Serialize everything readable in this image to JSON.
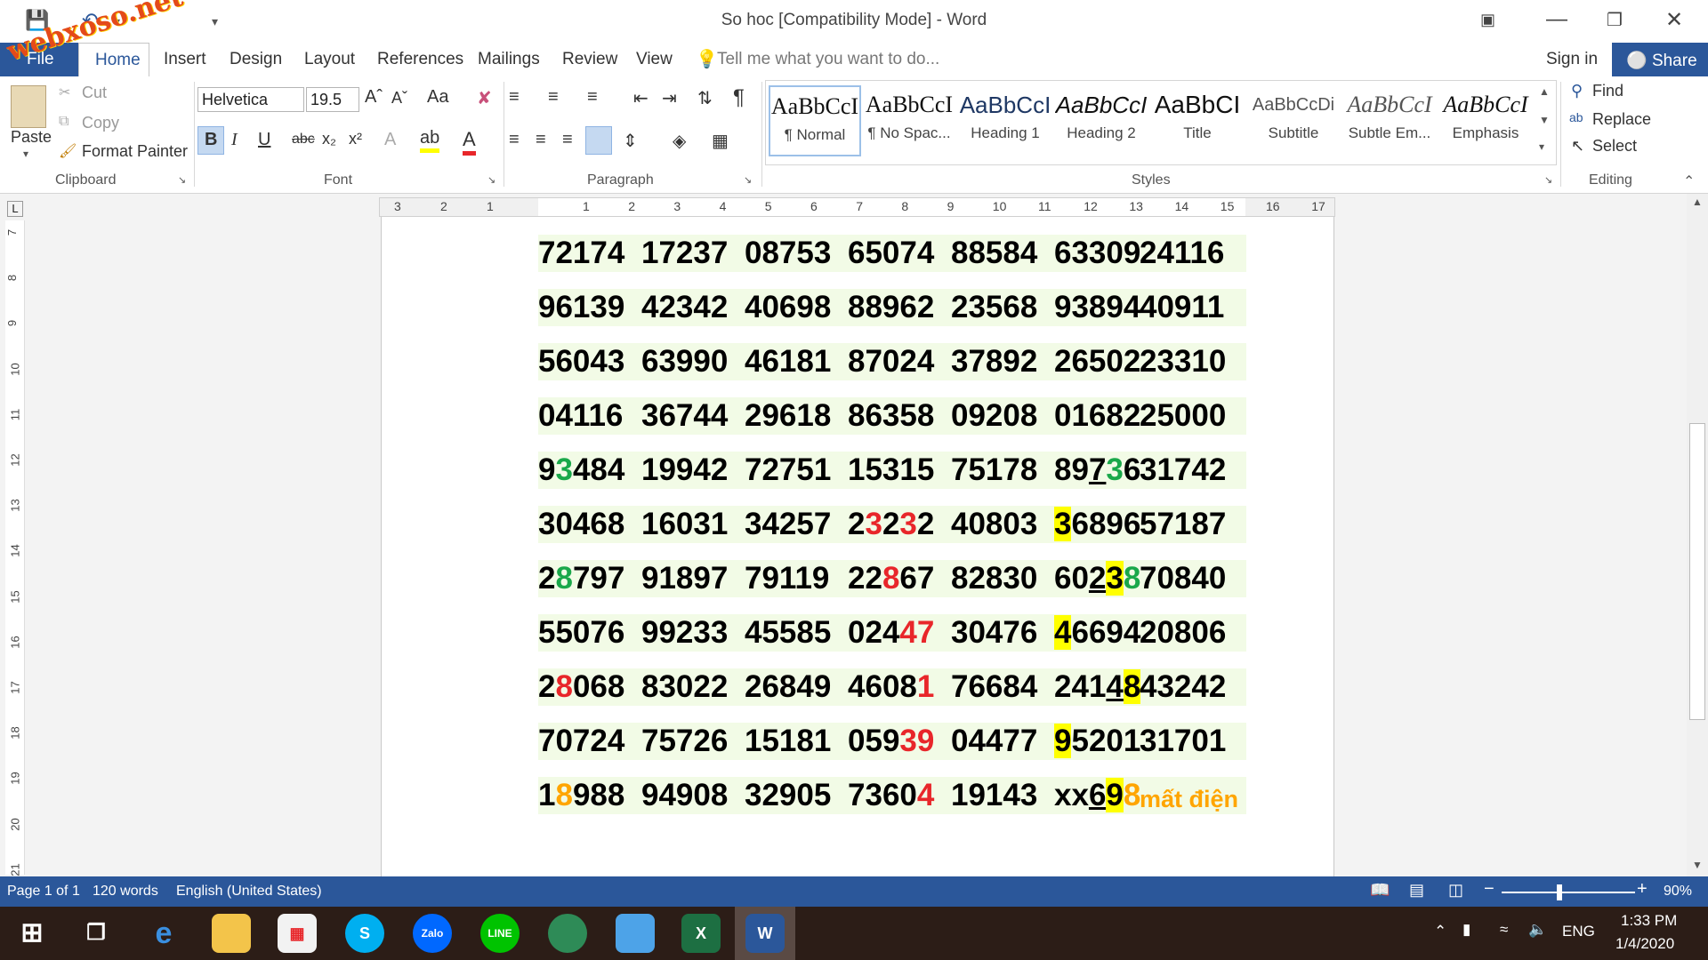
{
  "window": {
    "title": "So hoc [Compatibility Mode] - Word"
  },
  "watermark": "webxoso.net",
  "tabs": {
    "file": "File",
    "home": "Home",
    "items": [
      "Insert",
      "Design",
      "Layout",
      "References",
      "Mailings",
      "Review",
      "View"
    ],
    "tell_me": "Tell me what you want to do...",
    "sign_in": "Sign in",
    "share": "Share"
  },
  "clipboard": {
    "paste": "Paste",
    "cut": "Cut",
    "copy": "Copy",
    "format_painter": "Format Painter",
    "label": "Clipboard"
  },
  "font": {
    "name": "Helvetica",
    "size": "19.5",
    "label": "Font",
    "change_case": "Aa",
    "bold": "B",
    "italic": "I",
    "underline": "U",
    "strike": "abc"
  },
  "paragraph": {
    "label": "Paragraph"
  },
  "styles": {
    "label": "Styles",
    "items": [
      {
        "sample": "AaBbCcI",
        "name": "¶ Normal"
      },
      {
        "sample": "AaBbCcI",
        "name": "¶ No Spac..."
      },
      {
        "sample": "AaBbCcI",
        "name": "Heading 1"
      },
      {
        "sample": "AaBbCcI",
        "name": "Heading 2"
      },
      {
        "sample": "AaBbCI",
        "name": "Title"
      },
      {
        "sample": "AaBbCcDi",
        "name": "Subtitle"
      },
      {
        "sample": "AaBbCcI",
        "name": "Subtle Em..."
      },
      {
        "sample": "AaBbCcI",
        "name": "Emphasis"
      }
    ]
  },
  "editing": {
    "find": "Find",
    "replace": "Replace",
    "select": "Select",
    "label": "Editing"
  },
  "ruler": {
    "h_left": [
      "3",
      "2",
      "1"
    ],
    "h_right": [
      "1",
      "2",
      "3",
      "4",
      "5",
      "6",
      "7",
      "8",
      "9",
      "10",
      "11",
      "12",
      "13",
      "14",
      "15",
      "16",
      "17"
    ],
    "v": [
      "7",
      "8",
      "9",
      "10",
      "11",
      "12",
      "13",
      "14",
      "15",
      "16",
      "17",
      "18",
      "19",
      "20",
      "21"
    ]
  },
  "table_rows": [
    [
      "72174",
      "17237",
      "08753",
      "65074",
      "88584",
      "63309",
      "24116"
    ],
    [
      "96139",
      "42342",
      "40698",
      "88962",
      "23568",
      "93894",
      "40911"
    ],
    [
      "56043",
      "63990",
      "46181",
      "87024",
      "37892",
      "26502",
      "23310"
    ],
    [
      "04116",
      "36744",
      "29618",
      "86358",
      "09208",
      "01682",
      "25000"
    ],
    [
      "93484",
      "19942",
      "72751",
      "15315",
      "75178",
      "89736",
      "31742"
    ],
    [
      "30468",
      "16031",
      "34257",
      "23232",
      "40803",
      "36896",
      "57187"
    ],
    [
      "28797",
      "91897",
      "79119",
      "22867",
      "82830",
      "60238",
      "70840"
    ],
    [
      "55076",
      "99233",
      "45585",
      "02447",
      "30476",
      "46694",
      "20806"
    ],
    [
      "28068",
      "83022",
      "26849",
      "46081",
      "76684",
      "24148",
      "43242"
    ],
    [
      "70724",
      "75726",
      "15181",
      "05939",
      "04477",
      "95201",
      "31701"
    ],
    [
      "18988",
      "94908",
      "32905",
      "73604",
      "19143",
      "xx698",
      "mất điện"
    ]
  ],
  "status": {
    "page": "Page 1 of 1",
    "words": "120 words",
    "language": "English (United States)",
    "zoom": "90%"
  },
  "taskbar": {
    "lang": "ENG",
    "time": "1:33 PM",
    "date": "1/4/2020",
    "apps": [
      "edge-icon",
      "file-explorer-icon",
      "store-icon",
      "skype-icon",
      "zalo-icon",
      "line-icon",
      "coccoc-icon",
      "paint-icon",
      "excel-icon",
      "word-icon"
    ],
    "skype": "S",
    "zalo": "Zalo",
    "line": "LINE"
  },
  "colors": {
    "ribbon_blue": "#2b579a",
    "green_digit": "#1aa84a",
    "red_digit": "#e8262a",
    "orange_digit": "#ffa500",
    "highlight": "#ffff00",
    "row_band": "#f2fbe6"
  }
}
